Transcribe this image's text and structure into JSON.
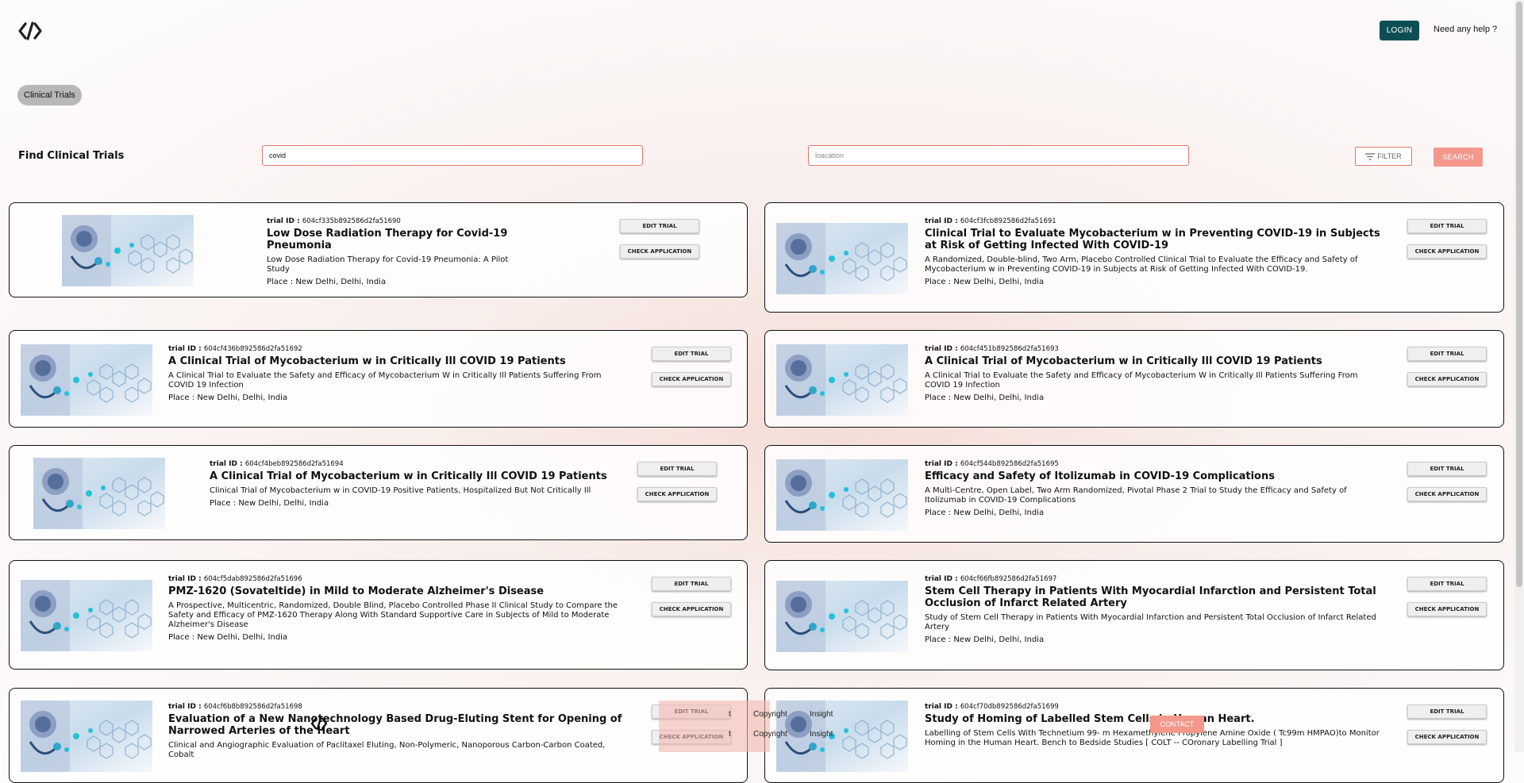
{
  "header": {
    "login_label": "LOGIN",
    "help_label": "Need any help ?"
  },
  "breadcrumb": {
    "chip_label": "Clinical Trials"
  },
  "search": {
    "title": "Find Clinical Trials",
    "query_value": "covid",
    "location_placeholder": "loacation",
    "filter_label": "FILTER",
    "search_label": "SEARCH"
  },
  "labels": {
    "trial_id": "trial ID : ",
    "place": "Place : ",
    "edit": "EDIT TRIAL",
    "check": "CHECK APPLICATION"
  },
  "trials": [
    {
      "id": "604cf335b892586d2fa51690",
      "title": "Low Dose Radiation Therapy for Covid-19 Pneumonia",
      "subtitle": "Low Dose Radiation Therapy for Covid-19 Pneumonia: A Pilot Study",
      "place": "New Delhi, Delhi, India"
    },
    {
      "id": "604cf3fcb892586d2fa51691",
      "title": "Clinical Trial to Evaluate Mycobacterium w in Preventing COVID-19 in Subjects at Risk of Getting Infected With COVID-19",
      "subtitle": "A Randomized, Double-blind, Two Arm, Placebo Controlled Clinical Trial to Evaluate the Efficacy and Safety of Mycobacterium w in Preventing COVID-19 in Subjects at Risk of Getting Infected With COVID-19.",
      "place": "New Delhi, Delhi, India"
    },
    {
      "id": "604cf436b892586d2fa51692",
      "title": "A Clinical Trial of Mycobacterium w in Critically Ill COVID 19 Patients",
      "subtitle": "A Clinical Trial to Evaluate the Safety and Efficacy of Mycobacterium W in Critically Ill Patients Suffering From COVID 19 Infection",
      "place": "New Delhi, Delhi, India"
    },
    {
      "id": "604cf451b892586d2fa51693",
      "title": "A Clinical Trial of Mycobacterium w in Critically Ill COVID 19 Patients",
      "subtitle": "A Clinical Trial to Evaluate the Safety and Efficacy of Mycobacterium W in Critically Ill Patients Suffering From COVID 19 Infection",
      "place": "New Delhi, Delhi, India"
    },
    {
      "id": "604cf4beb892586d2fa51694",
      "title": "A Clinical Trial of Mycobacterium w in Critically Ill COVID 19 Patients",
      "subtitle": "Clinical Trial of Mycobacterium w in COVID-19 Positive Patients, Hospitalized But Not Critically Ill",
      "place": "New Delhi, Delhi, India"
    },
    {
      "id": "604cf544b892586d2fa51695",
      "title": "Efficacy and Safety of Itolizumab in COVID-19 Complications",
      "subtitle": "A Multi-Centre, Open Label, Two Arm Randomized, Pivotal Phase 2 Trial to Study the Efficacy and Safety of Itolizumab in COVID-19 Complications",
      "place": "New Delhi, Delhi, India"
    },
    {
      "id": "604cf5dab892586d2fa51696",
      "title": "PMZ-1620 (Sovateltide) in Mild to Moderate Alzheimer's Disease",
      "subtitle": "A Prospective, Multicentric, Randomized, Double Blind, Placebo Controlled Phase II Clinical Study to Compare the Safety and Efficacy of PMZ-1620 Therapy Along With Standard Supportive Care in Subjects of Mild to Moderate Alzheimer's Disease",
      "place": "New Delhi, Delhi, India"
    },
    {
      "id": "604cf66fb892586d2fa51697",
      "title": "Stem Cell Therapy in Patients With Myocardial Infarction and Persistent Total Occlusion of Infarct Related Artery",
      "subtitle": "Study of Stem Cell Therapy in Patients With Myocardial Infarction and Persistent Total Occlusion of Infarct Related Artery",
      "place": "New Delhi, Delhi, India"
    },
    {
      "id": "604cf6b8b892586d2fa51698",
      "title": "Evaluation of a New Nanotechnology Based Drug-Eluting Stent for Opening of Narrowed Arteries of the Heart",
      "subtitle": "Clinical and Angiographic Evaluation of Paclitaxel Eluting, Non-Polymeric, Nanoporous Carbon-Carbon Coated, Cobalt",
      "place": ""
    },
    {
      "id": "604cf70db892586d2fa51699",
      "title": "Study of Homing of Labelled Stem Cells in Human Heart.",
      "subtitle": "Labelling of Stem Cells With Technetium 99- m Hexamethylene Propylene Amine Oxide ( Tc99m HMPAO)to Monitor Homing in the Human Heart. Bench to Bedside Studies [ COLT -- COronary Labelling Trial ]",
      "place": ""
    }
  ],
  "footer": {
    "copyright_1": "Copyright",
    "copyright_2": "Copyright",
    "insight_1": "Insight",
    "insight_2": "Insight",
    "frag_1": "t",
    "frag_2": "t",
    "contact_label": "CONTACT"
  }
}
